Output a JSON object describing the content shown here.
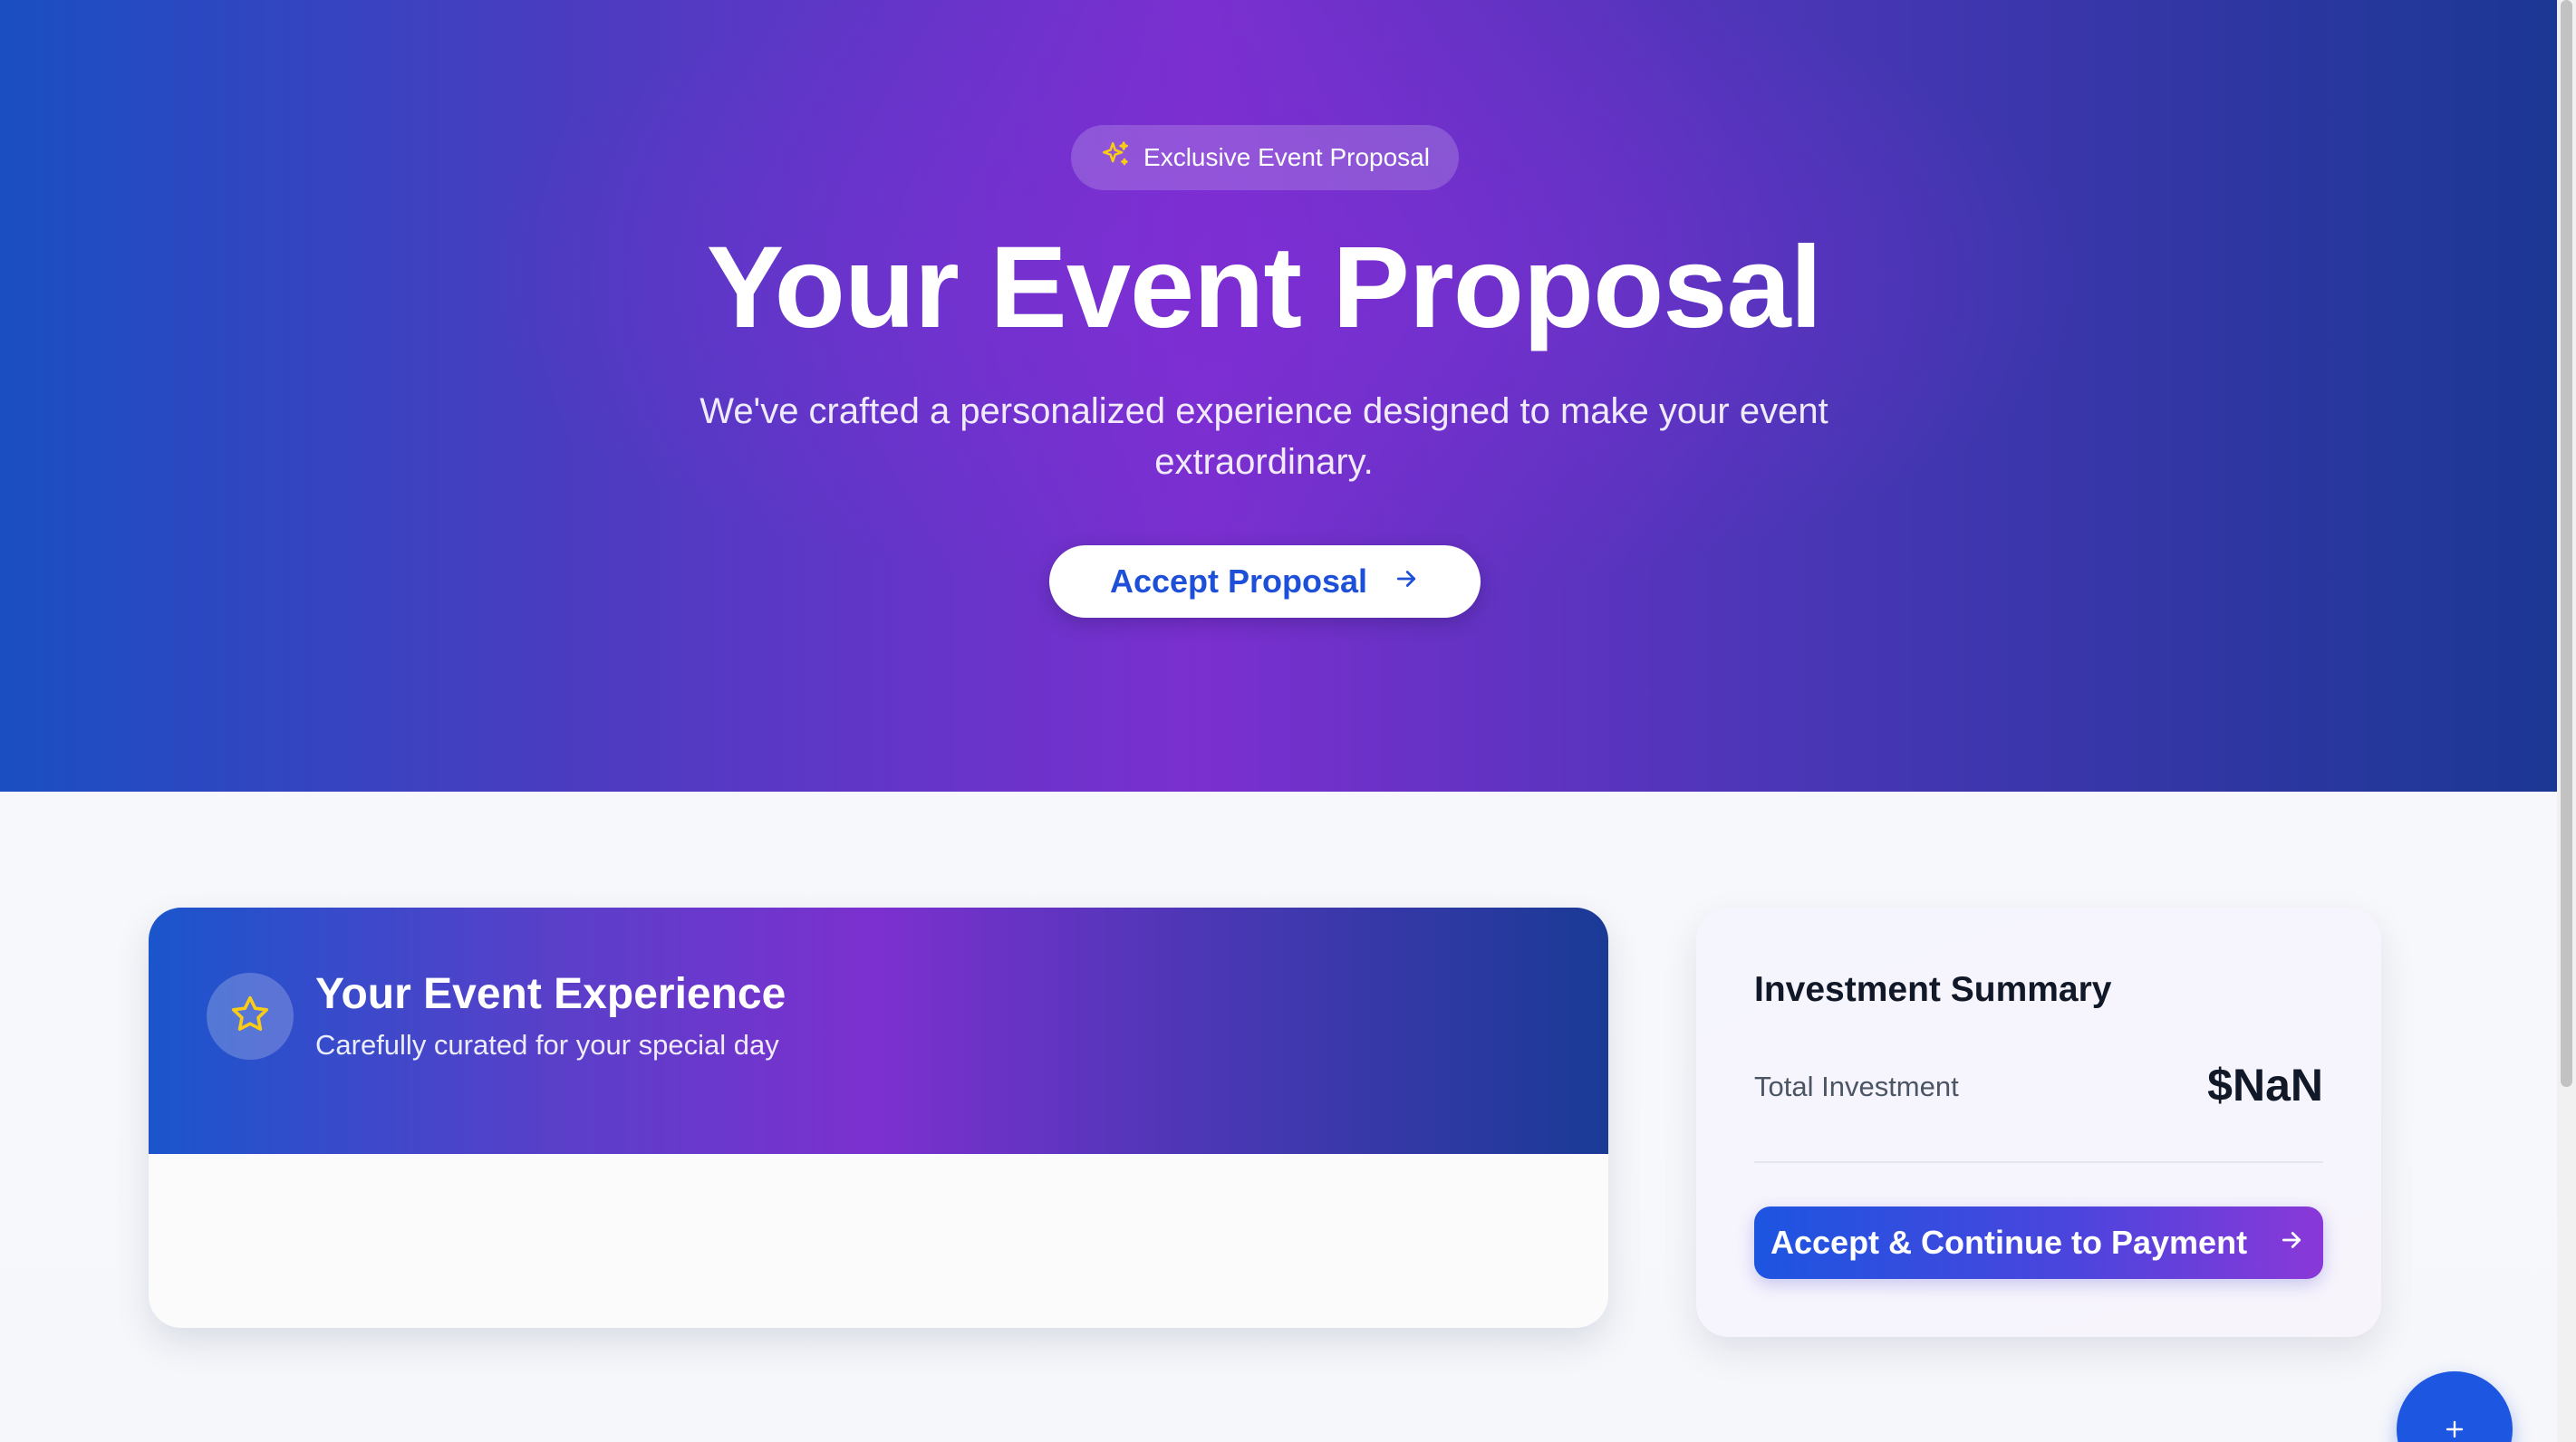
{
  "hero": {
    "badge_label": "Exclusive Event Proposal",
    "badge_icon": "sparkles-icon",
    "title": "Your Event Proposal",
    "subtitle": "We've crafted a personalized experience designed to make your event extraordinary.",
    "accept_button_label": "Accept Proposal",
    "accept_button_icon": "arrow-right-icon"
  },
  "event_card": {
    "icon": "star-icon",
    "title": "Your Event Experience",
    "subtitle": "Carefully curated for your special day"
  },
  "summary": {
    "title": "Investment Summary",
    "total_label": "Total Investment",
    "total_value": "$NaN",
    "payment_button_label": "Accept & Continue to Payment",
    "payment_button_icon": "arrow-right-icon"
  },
  "fab": {
    "icon": "plus-icon"
  },
  "colors": {
    "primary_blue": "#1d4fd8",
    "accent_purple": "#7c30cf",
    "star_yellow": "#facc15",
    "text_dark": "#111827"
  }
}
